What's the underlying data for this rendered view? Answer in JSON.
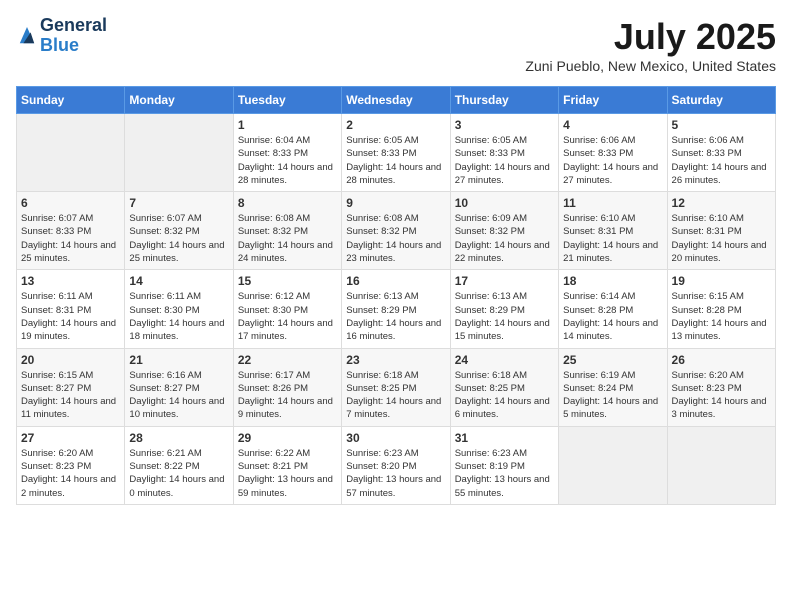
{
  "logo": {
    "general": "General",
    "blue": "Blue"
  },
  "title": "July 2025",
  "location": "Zuni Pueblo, New Mexico, United States",
  "days_of_week": [
    "Sunday",
    "Monday",
    "Tuesday",
    "Wednesday",
    "Thursday",
    "Friday",
    "Saturday"
  ],
  "weeks": [
    [
      {
        "day": "",
        "info": ""
      },
      {
        "day": "",
        "info": ""
      },
      {
        "day": "1",
        "info": "Sunrise: 6:04 AM\nSunset: 8:33 PM\nDaylight: 14 hours and 28 minutes."
      },
      {
        "day": "2",
        "info": "Sunrise: 6:05 AM\nSunset: 8:33 PM\nDaylight: 14 hours and 28 minutes."
      },
      {
        "day": "3",
        "info": "Sunrise: 6:05 AM\nSunset: 8:33 PM\nDaylight: 14 hours and 27 minutes."
      },
      {
        "day": "4",
        "info": "Sunrise: 6:06 AM\nSunset: 8:33 PM\nDaylight: 14 hours and 27 minutes."
      },
      {
        "day": "5",
        "info": "Sunrise: 6:06 AM\nSunset: 8:33 PM\nDaylight: 14 hours and 26 minutes."
      }
    ],
    [
      {
        "day": "6",
        "info": "Sunrise: 6:07 AM\nSunset: 8:33 PM\nDaylight: 14 hours and 25 minutes."
      },
      {
        "day": "7",
        "info": "Sunrise: 6:07 AM\nSunset: 8:32 PM\nDaylight: 14 hours and 25 minutes."
      },
      {
        "day": "8",
        "info": "Sunrise: 6:08 AM\nSunset: 8:32 PM\nDaylight: 14 hours and 24 minutes."
      },
      {
        "day": "9",
        "info": "Sunrise: 6:08 AM\nSunset: 8:32 PM\nDaylight: 14 hours and 23 minutes."
      },
      {
        "day": "10",
        "info": "Sunrise: 6:09 AM\nSunset: 8:32 PM\nDaylight: 14 hours and 22 minutes."
      },
      {
        "day": "11",
        "info": "Sunrise: 6:10 AM\nSunset: 8:31 PM\nDaylight: 14 hours and 21 minutes."
      },
      {
        "day": "12",
        "info": "Sunrise: 6:10 AM\nSunset: 8:31 PM\nDaylight: 14 hours and 20 minutes."
      }
    ],
    [
      {
        "day": "13",
        "info": "Sunrise: 6:11 AM\nSunset: 8:31 PM\nDaylight: 14 hours and 19 minutes."
      },
      {
        "day": "14",
        "info": "Sunrise: 6:11 AM\nSunset: 8:30 PM\nDaylight: 14 hours and 18 minutes."
      },
      {
        "day": "15",
        "info": "Sunrise: 6:12 AM\nSunset: 8:30 PM\nDaylight: 14 hours and 17 minutes."
      },
      {
        "day": "16",
        "info": "Sunrise: 6:13 AM\nSunset: 8:29 PM\nDaylight: 14 hours and 16 minutes."
      },
      {
        "day": "17",
        "info": "Sunrise: 6:13 AM\nSunset: 8:29 PM\nDaylight: 14 hours and 15 minutes."
      },
      {
        "day": "18",
        "info": "Sunrise: 6:14 AM\nSunset: 8:28 PM\nDaylight: 14 hours and 14 minutes."
      },
      {
        "day": "19",
        "info": "Sunrise: 6:15 AM\nSunset: 8:28 PM\nDaylight: 14 hours and 13 minutes."
      }
    ],
    [
      {
        "day": "20",
        "info": "Sunrise: 6:15 AM\nSunset: 8:27 PM\nDaylight: 14 hours and 11 minutes."
      },
      {
        "day": "21",
        "info": "Sunrise: 6:16 AM\nSunset: 8:27 PM\nDaylight: 14 hours and 10 minutes."
      },
      {
        "day": "22",
        "info": "Sunrise: 6:17 AM\nSunset: 8:26 PM\nDaylight: 14 hours and 9 minutes."
      },
      {
        "day": "23",
        "info": "Sunrise: 6:18 AM\nSunset: 8:25 PM\nDaylight: 14 hours and 7 minutes."
      },
      {
        "day": "24",
        "info": "Sunrise: 6:18 AM\nSunset: 8:25 PM\nDaylight: 14 hours and 6 minutes."
      },
      {
        "day": "25",
        "info": "Sunrise: 6:19 AM\nSunset: 8:24 PM\nDaylight: 14 hours and 5 minutes."
      },
      {
        "day": "26",
        "info": "Sunrise: 6:20 AM\nSunset: 8:23 PM\nDaylight: 14 hours and 3 minutes."
      }
    ],
    [
      {
        "day": "27",
        "info": "Sunrise: 6:20 AM\nSunset: 8:23 PM\nDaylight: 14 hours and 2 minutes."
      },
      {
        "day": "28",
        "info": "Sunrise: 6:21 AM\nSunset: 8:22 PM\nDaylight: 14 hours and 0 minutes."
      },
      {
        "day": "29",
        "info": "Sunrise: 6:22 AM\nSunset: 8:21 PM\nDaylight: 13 hours and 59 minutes."
      },
      {
        "day": "30",
        "info": "Sunrise: 6:23 AM\nSunset: 8:20 PM\nDaylight: 13 hours and 57 minutes."
      },
      {
        "day": "31",
        "info": "Sunrise: 6:23 AM\nSunset: 8:19 PM\nDaylight: 13 hours and 55 minutes."
      },
      {
        "day": "",
        "info": ""
      },
      {
        "day": "",
        "info": ""
      }
    ]
  ]
}
